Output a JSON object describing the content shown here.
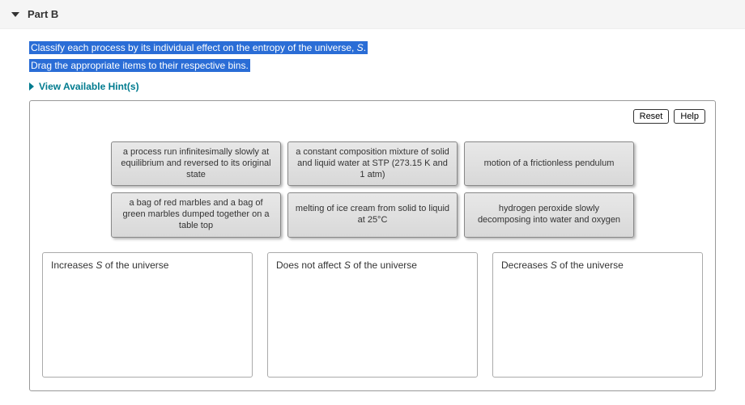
{
  "header": {
    "title": "Part B"
  },
  "prompt": {
    "line1_prefix": "Classify each process by its individual effect on the entropy of the universe, ",
    "line1_symbol": "S",
    "line1_suffix": ".",
    "line2": "Drag the appropriate items to their respective bins."
  },
  "hints": {
    "label": "View Available Hint(s)"
  },
  "toolbar": {
    "reset": "Reset",
    "help": "Help"
  },
  "items": {
    "row1": [
      "a process run infinitesimally slowly at equilibrium and reversed to its original state",
      "a constant composition mixture of solid and liquid water at STP (273.15 K and 1 atm)",
      "motion of a frictionless pendulum"
    ],
    "row2": [
      "a bag of red marbles and a bag of green marbles dumped together on a table top",
      "melting of ice cream from solid to liquid at 25°C",
      "hydrogen peroxide slowly decomposing into water and oxygen"
    ]
  },
  "bins": {
    "increase": {
      "prefix": "Increases ",
      "symbol": "S",
      "suffix": " of the universe"
    },
    "noeffect": {
      "prefix": "Does not affect ",
      "symbol": "S",
      "suffix": " of the universe"
    },
    "decrease": {
      "prefix": "Decreases ",
      "symbol": "S",
      "suffix": " of the universe"
    }
  }
}
